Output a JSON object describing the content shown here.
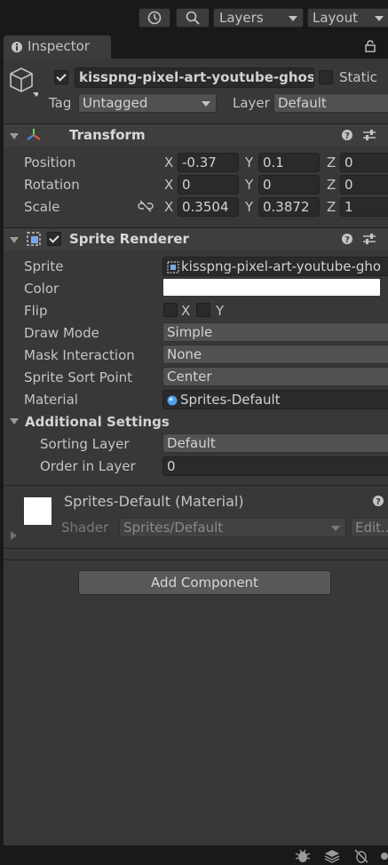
{
  "toolbar": {
    "layers_label": "Layers",
    "layout_label": "Layout"
  },
  "tab": {
    "label": "Inspector"
  },
  "object": {
    "name": "kisspng-pixel-art-youtube-ghost-i",
    "static_label": "Static",
    "tag_label": "Tag",
    "tag_value": "Untagged",
    "layer_label": "Layer",
    "layer_value": "Default"
  },
  "transform": {
    "title": "Transform",
    "position_label": "Position",
    "rotation_label": "Rotation",
    "scale_label": "Scale",
    "x": "X",
    "y": "Y",
    "z": "Z",
    "position": {
      "x": "-0.37",
      "y": "0.1",
      "z": "0"
    },
    "rotation": {
      "x": "0",
      "y": "0",
      "z": "0"
    },
    "scale": {
      "x": "0.3504",
      "y": "0.3872",
      "z": "1"
    }
  },
  "sprite_renderer": {
    "title": "Sprite Renderer",
    "sprite_label": "Sprite",
    "sprite_value": "kisspng-pixel-art-youtube-gho",
    "color_label": "Color",
    "color_value": "#ffffff",
    "flip_label": "Flip",
    "flip_x": "X",
    "flip_y": "Y",
    "draw_mode_label": "Draw Mode",
    "draw_mode_value": "Simple",
    "mask_label": "Mask Interaction",
    "mask_value": "None",
    "sort_point_label": "Sprite Sort Point",
    "sort_point_value": "Center",
    "material_label": "Material",
    "material_value": "Sprites-Default",
    "additional_label": "Additional Settings",
    "sorting_layer_label": "Sorting Layer",
    "sorting_layer_value": "Default",
    "order_label": "Order in Layer",
    "order_value": "0"
  },
  "material_section": {
    "title": "Sprites-Default (Material)",
    "shader_label": "Shader",
    "shader_value": "Sprites/Default",
    "edit_label": "Edit..."
  },
  "add_component_label": "Add Component"
}
